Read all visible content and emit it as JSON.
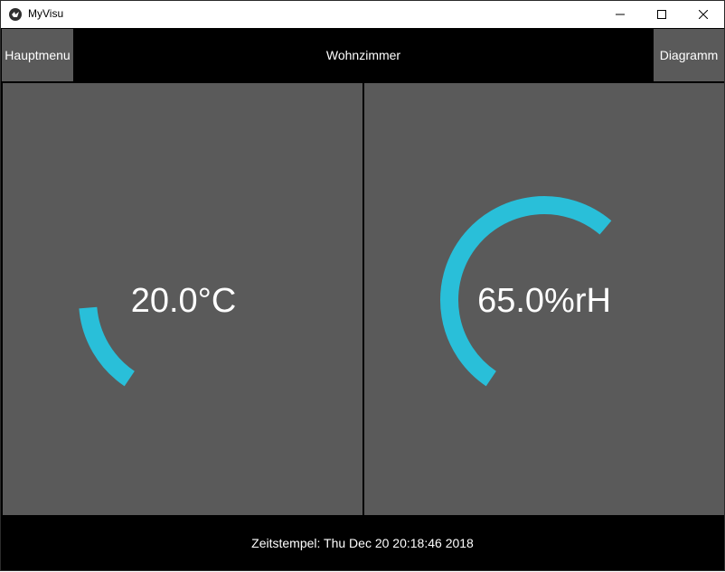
{
  "window": {
    "title": "MyVisu"
  },
  "header": {
    "left_button": "Hauptmenu",
    "title": "Wohnzimmer",
    "right_button": "Diagramm"
  },
  "gauges": [
    {
      "name": "temperature",
      "display": "20.0°C",
      "value": 20.0,
      "fill_fraction": 0.19,
      "color": "#29bfd9"
    },
    {
      "name": "humidity",
      "display": "65.0%rH",
      "value": 65.0,
      "fill_fraction": 0.69,
      "color": "#29bfd9"
    }
  ],
  "footer": {
    "timestamp": "Zeitstempel: Thu Dec 20 20:18:46 2018"
  },
  "colors": {
    "panel": "#5a5a5a",
    "background": "#000000",
    "arc": "#29bfd9"
  }
}
